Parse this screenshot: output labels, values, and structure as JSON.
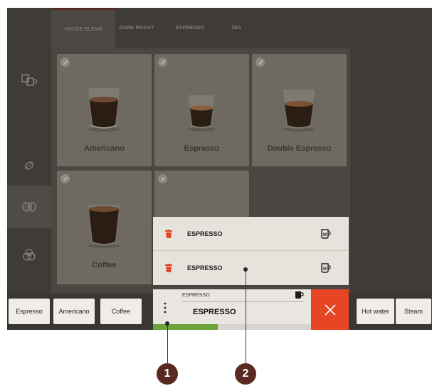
{
  "tabs": [
    {
      "label": "HOUSE BLEND",
      "active": true
    },
    {
      "label": "DARK ROAST",
      "active": false
    },
    {
      "label": "ESPRESSO",
      "active": false
    },
    {
      "label": "TEA",
      "active": false
    }
  ],
  "sidebar": {
    "items": [
      {
        "icon": "cups-icon",
        "active": false
      },
      {
        "icon": "coffee-bean-icon",
        "active": false
      },
      {
        "icon": "beans-pair-icon",
        "active": true
      },
      {
        "icon": "bean-bag-icon",
        "active": false
      }
    ]
  },
  "products": [
    {
      "label": "Americano",
      "cup": "americano"
    },
    {
      "label": "Espresso",
      "cup": "espresso"
    },
    {
      "label": "Double Espresso",
      "cup": "double"
    },
    {
      "label": "Coffee",
      "cup": "coffee"
    },
    {
      "label": "",
      "cup": "none"
    }
  ],
  "shortcut_bar": {
    "left": [
      "Espresso",
      "Americano",
      "Coffee"
    ],
    "right": [
      "Hot water",
      "Steam"
    ]
  },
  "queue": {
    "items": [
      {
        "label": "ESPRESSO"
      },
      {
        "label": "ESPRESSO"
      }
    ]
  },
  "active_brew": {
    "small_label": "ESPRESSO",
    "name": "ESPRESSO",
    "progress": 0.41
  },
  "callouts": {
    "one": "1",
    "two": "2"
  },
  "colors": {
    "accent_red": "#e64624",
    "progress_green": "#6aa23c",
    "callout_brown": "#5a2a20"
  }
}
